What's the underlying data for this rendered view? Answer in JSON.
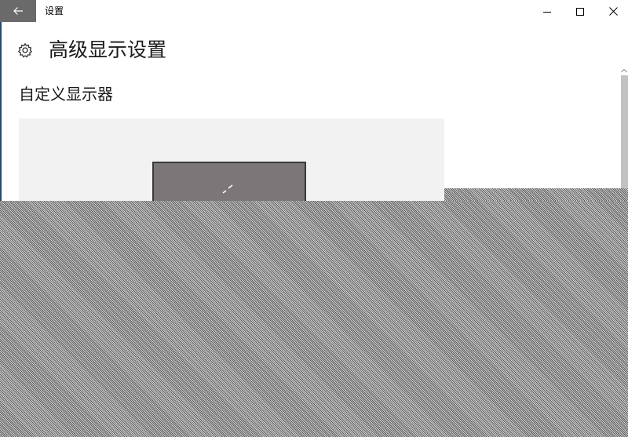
{
  "titlebar": {
    "back_icon": "back-arrow-icon",
    "app_title": "设置",
    "minimize_icon": "minimize-icon",
    "maximize_icon": "maximize-icon",
    "close_icon": "close-icon"
  },
  "header": {
    "icon": "gear-icon",
    "title": "高级显示设置"
  },
  "section": {
    "title": "自定义显示器"
  },
  "colors": {
    "back_button_bg": "#6a6a6a",
    "preview_bg": "#f2f2f2",
    "monitor_fill": "#7b7678"
  }
}
